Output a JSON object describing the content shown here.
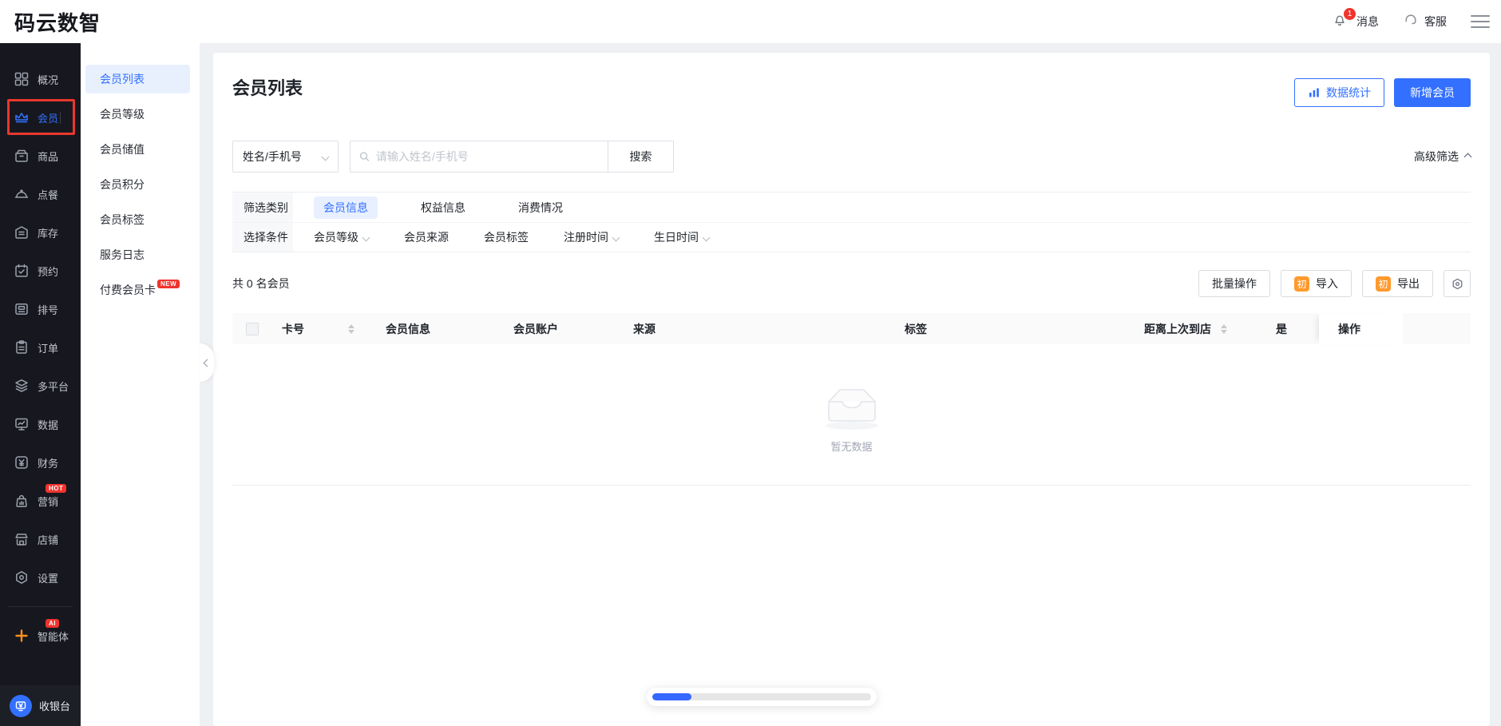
{
  "colors": {
    "accent": "#3370ff",
    "danger": "#f0342c",
    "orange": "#ff9a2e",
    "sidebar_bg": "#17181f"
  },
  "topbar": {
    "logo": "码云数智",
    "message_label": "消息",
    "message_badge": "1",
    "service_label": "客服"
  },
  "sidebar": {
    "items": [
      {
        "label": "概况",
        "icon": "grid-icon"
      },
      {
        "label": "会员",
        "icon": "crown-icon",
        "active": true
      },
      {
        "label": "商品",
        "icon": "box-icon"
      },
      {
        "label": "点餐",
        "icon": "cloche-icon"
      },
      {
        "label": "库存",
        "icon": "storage-icon"
      },
      {
        "label": "预约",
        "icon": "calendar-check-icon"
      },
      {
        "label": "排号",
        "icon": "ticket-machine-icon"
      },
      {
        "label": "订单",
        "icon": "clipboard-icon"
      },
      {
        "label": "多平台",
        "icon": "layers-icon"
      },
      {
        "label": "数据",
        "icon": "monitor-chart-icon"
      },
      {
        "label": "财务",
        "icon": "yuan-square-icon"
      },
      {
        "label": "营销",
        "icon": "marketing-bag-icon",
        "badge": "HOT"
      },
      {
        "label": "店铺",
        "icon": "storefront-icon"
      },
      {
        "label": "设置",
        "icon": "gear-icon"
      }
    ],
    "agent": {
      "label": "智能体",
      "icon": "clover-icon",
      "badge": "AI"
    },
    "cashier": {
      "label": "收银台",
      "icon": "cashier-icon"
    }
  },
  "submenu": {
    "items": [
      {
        "label": "会员列表",
        "active": true
      },
      {
        "label": "会员等级"
      },
      {
        "label": "会员储值"
      },
      {
        "label": "会员积分"
      },
      {
        "label": "会员标签"
      },
      {
        "label": "服务日志"
      },
      {
        "label": "付费会员卡",
        "badge": "NEW"
      }
    ]
  },
  "page": {
    "title": "会员列表",
    "stats_button": "数据统计",
    "add_button": "新增会员"
  },
  "search": {
    "field_selector": "姓名/手机号",
    "placeholder": "请输入姓名/手机号",
    "search_button": "搜索",
    "advanced_filter": "高级筛选"
  },
  "filter": {
    "category_label": "筛选类别",
    "category_tabs": [
      {
        "label": "会员信息",
        "active": true
      },
      {
        "label": "权益信息"
      },
      {
        "label": "消费情况"
      }
    ],
    "condition_label": "选择条件",
    "conditions": [
      {
        "label": "会员等级",
        "dropdown": true
      },
      {
        "label": "会员来源",
        "dropdown": false
      },
      {
        "label": "会员标签",
        "dropdown": false
      },
      {
        "label": "注册时间",
        "dropdown": true
      },
      {
        "label": "生日时间",
        "dropdown": true
      }
    ]
  },
  "toolbar": {
    "count_text": "共 0 名会员",
    "bulk_button": "批量操作",
    "import_button": "导入",
    "export_button": "导出",
    "guide_badge": "初"
  },
  "table": {
    "columns": [
      {
        "label": "卡号",
        "sortable": true
      },
      {
        "label": "会员信息"
      },
      {
        "label": "会员账户"
      },
      {
        "label": "来源"
      },
      {
        "label": "标签"
      },
      {
        "label": "距离上次到店",
        "sortable": true
      },
      {
        "label": "是",
        "clipped": true
      },
      {
        "label": "操作",
        "fixed": true
      }
    ],
    "empty_text": "暂无数据"
  },
  "loading": {
    "percent": 18
  }
}
